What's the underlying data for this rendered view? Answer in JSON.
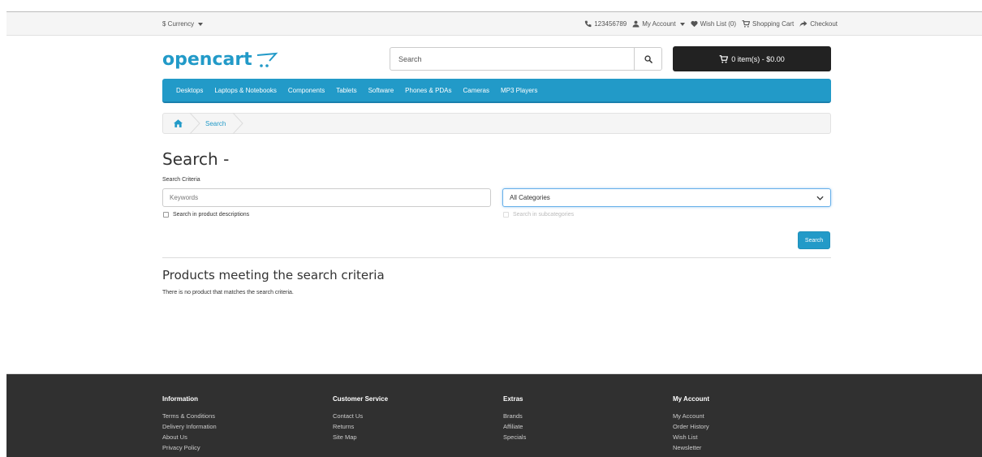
{
  "topbar": {
    "currency": "$ Currency",
    "phone": "123456789",
    "my_account": "My Account",
    "wishlist": "Wish List (0)",
    "shopping_cart": "Shopping Cart",
    "checkout": "Checkout"
  },
  "header": {
    "logo": "opencart",
    "search_placeholder": "Search",
    "cart_label": "0 item(s) - $0.00"
  },
  "menu": {
    "items": [
      "Desktops",
      "Laptops & Notebooks",
      "Components",
      "Tablets",
      "Software",
      "Phones & PDAs",
      "Cameras",
      "MP3 Players"
    ]
  },
  "breadcrumb": {
    "current": "Search"
  },
  "page": {
    "title": "Search -",
    "criteria_label": "Search Criteria",
    "keywords_placeholder": "Keywords",
    "category_selected": "All Categories",
    "search_descriptions": "Search in product descriptions",
    "search_subcategories": "Search in subcategories",
    "search_button": "Search",
    "results_heading": "Products meeting the search criteria",
    "no_results": "There is no product that matches the search criteria."
  },
  "footer": {
    "columns": [
      {
        "title": "Information",
        "links": [
          "Terms & Conditions",
          "Delivery Information",
          "About Us",
          "Privacy Policy"
        ]
      },
      {
        "title": "Customer Service",
        "links": [
          "Contact Us",
          "Returns",
          "Site Map"
        ]
      },
      {
        "title": "Extras",
        "links": [
          "Brands",
          "Affiliate",
          "Specials"
        ]
      },
      {
        "title": "My Account",
        "links": [
          "My Account",
          "Order History",
          "Wish List",
          "Newsletter"
        ]
      }
    ]
  },
  "colors": {
    "accent": "#229ac8",
    "cart_bg": "#222222",
    "footer_bg": "#303030"
  }
}
